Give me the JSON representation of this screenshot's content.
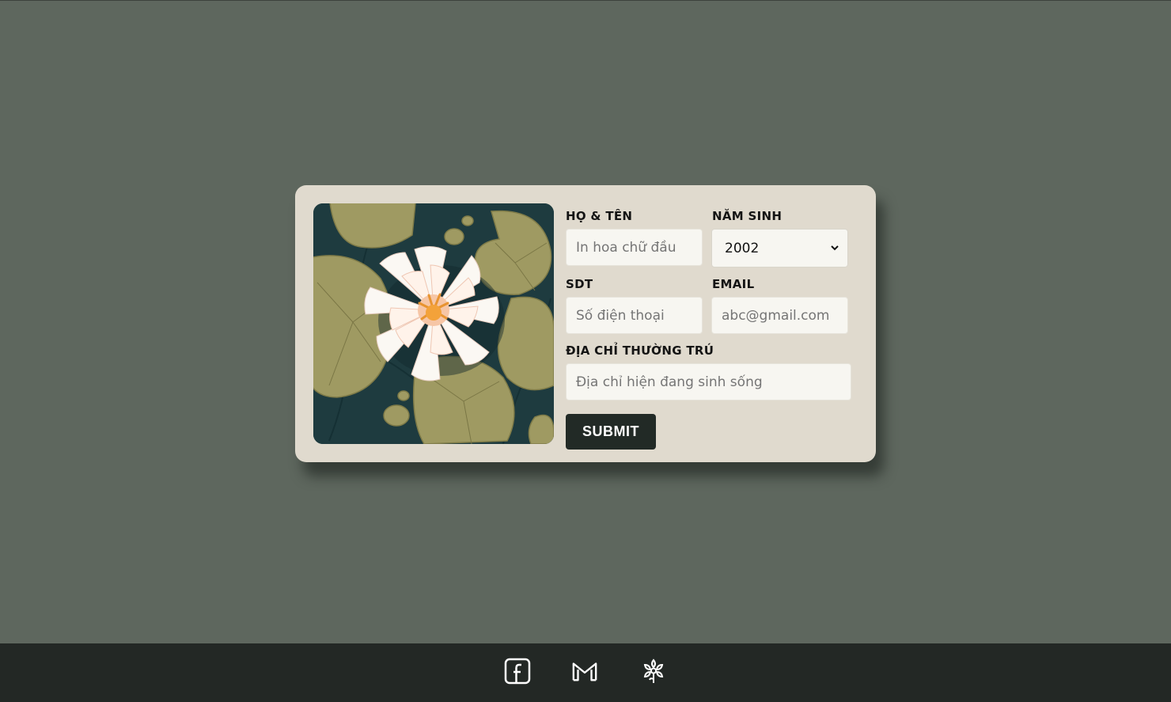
{
  "form": {
    "name": {
      "label": "HỌ & TÊN",
      "placeholder": "In hoa chữ đầu"
    },
    "birth_year": {
      "label": "NĂM SINH",
      "selected": "2002"
    },
    "phone": {
      "label": "SDT",
      "placeholder": "Số điện thoại"
    },
    "email": {
      "label": "EMAIL",
      "placeholder": "abc@gmail.com"
    },
    "address": {
      "label": "ĐỊA CHỈ THƯỜNG TRÚ",
      "placeholder": "Địa chỉ hiện đang sinh sống"
    },
    "submit_label": "SUBMIT"
  },
  "illustration": {
    "subject": "water-lily-on-lily-pads",
    "icon": "lotus-illustration"
  },
  "footer": {
    "icons": [
      {
        "name": "facebook-icon"
      },
      {
        "name": "gmail-icon"
      },
      {
        "name": "flower-icon"
      }
    ]
  },
  "colors": {
    "page_background": "#5e675e",
    "card_background": "#e0dace",
    "button_background": "#222a26",
    "footer_background": "#232825"
  }
}
